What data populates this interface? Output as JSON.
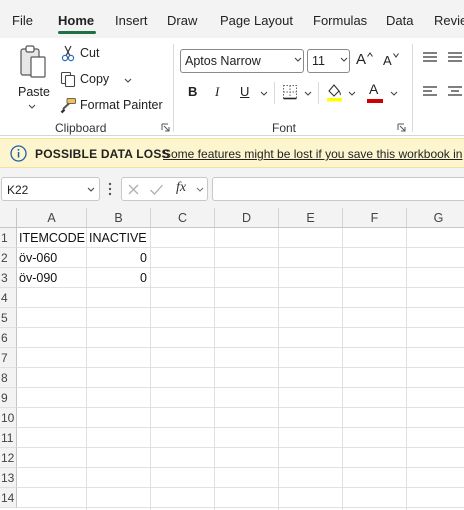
{
  "tabs": [
    {
      "label": "File",
      "active": false
    },
    {
      "label": "Home",
      "active": true
    },
    {
      "label": "Insert",
      "active": false
    },
    {
      "label": "Draw",
      "active": false
    },
    {
      "label": "Page Layout",
      "active": false
    },
    {
      "label": "Formulas",
      "active": false
    },
    {
      "label": "Data",
      "active": false
    },
    {
      "label": "Revie",
      "active": false
    }
  ],
  "ribbon": {
    "clipboard": {
      "paste_label": "Paste",
      "cut_label": "Cut",
      "copy_label": "Copy",
      "format_painter_label": "Format Painter",
      "group_label": "Clipboard"
    },
    "font": {
      "font_name": "Aptos Narrow",
      "font_size": "11",
      "bold_glyph": "B",
      "italic_glyph": "I",
      "underline_glyph": "U",
      "font_color_glyph": "A",
      "grow_glyph": "A",
      "shrink_glyph": "A",
      "highlight_color": "#ffff00",
      "font_color": "#d00000",
      "group_label": "Font"
    }
  },
  "infobar": {
    "title": "POSSIBLE DATA LOSS",
    "message": "Some features might be lost if you save this workbook in"
  },
  "formula_bar": {
    "name_box": "K22",
    "fx_label": "fx",
    "formula": ""
  },
  "sheet": {
    "columns": [
      "A",
      "B",
      "C",
      "D",
      "E",
      "F",
      "G"
    ],
    "rows": [
      "1",
      "2",
      "3",
      "4",
      "5",
      "6",
      "7",
      "8",
      "9",
      "10",
      "11",
      "12",
      "13",
      "14"
    ],
    "cells": {
      "r1": {
        "a": "ITEMCODE",
        "b": "INACTIVE"
      },
      "r2": {
        "a": "öv-060",
        "b": "0"
      },
      "r3": {
        "a": "öv-090",
        "b": "0"
      }
    }
  },
  "colors": {
    "accent": "#1e7145",
    "infobar_bg": "#fdf5cd",
    "ribbon_bg": "#f3f3f3"
  }
}
